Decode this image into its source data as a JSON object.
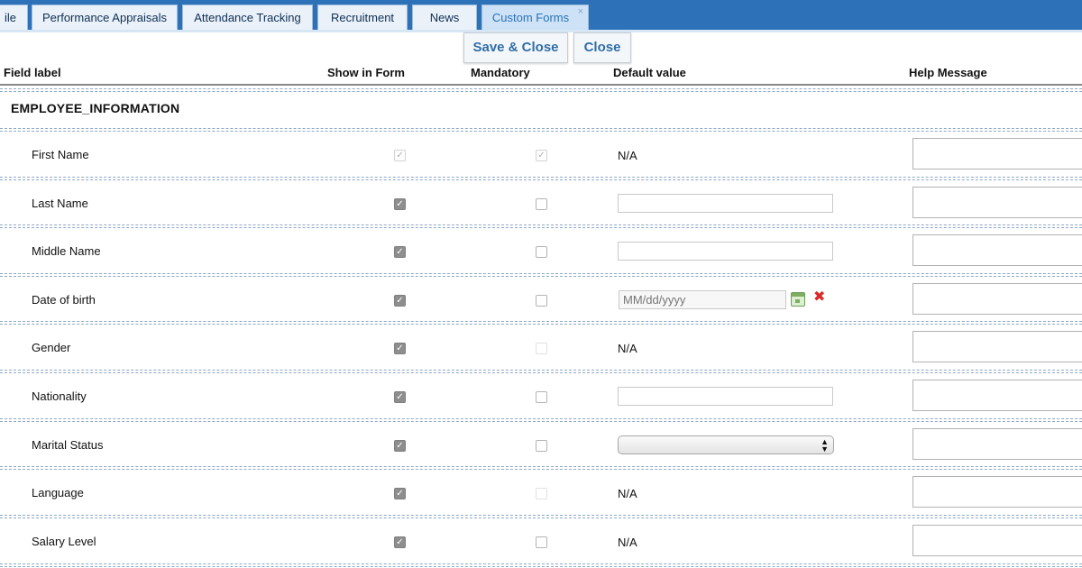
{
  "tabs": [
    {
      "label": "ile"
    },
    {
      "label": "Performance Appraisals"
    },
    {
      "label": "Attendance Tracking"
    },
    {
      "label": "Recruitment"
    },
    {
      "label": "News"
    },
    {
      "label": "Custom Forms",
      "close": "×"
    }
  ],
  "toolbar": {
    "save_close_label": "Save & Close",
    "close_label": "Close"
  },
  "columns": {
    "field_label": "Field label",
    "show_in_form": "Show in Form",
    "mandatory": "Mandatory",
    "default_value": "Default value",
    "help_message": "Help Message"
  },
  "section": {
    "title": "EMPLOYEE_INFORMATION"
  },
  "rows": [
    {
      "label": "First Name",
      "show": "checked-disabled",
      "mandatory": "checked-disabled",
      "default_type": "na",
      "default_text": "N/A"
    },
    {
      "label": "Last Name",
      "show": "checked",
      "mandatory": "unchecked",
      "default_type": "text",
      "default_text": ""
    },
    {
      "label": "Middle Name",
      "show": "checked",
      "mandatory": "unchecked",
      "default_type": "text",
      "default_text": ""
    },
    {
      "label": "Date of birth",
      "show": "checked",
      "mandatory": "unchecked",
      "default_type": "date",
      "default_placeholder": "MM/dd/yyyy"
    },
    {
      "label": "Gender",
      "show": "checked",
      "mandatory": "disabled",
      "default_type": "na",
      "default_text": "N/A"
    },
    {
      "label": "Nationality",
      "show": "checked",
      "mandatory": "unchecked",
      "default_type": "text",
      "default_text": ""
    },
    {
      "label": "Marital Status",
      "show": "checked",
      "mandatory": "unchecked",
      "default_type": "select",
      "default_text": ""
    },
    {
      "label": "Language",
      "show": "checked",
      "mandatory": "disabled",
      "default_type": "na",
      "default_text": "N/A"
    },
    {
      "label": "Salary Level",
      "show": "checked",
      "mandatory": "unchecked",
      "default_type": "na",
      "default_text": "N/A"
    }
  ],
  "icons": {
    "checkmark": "✓",
    "calendar": "calendar-icon",
    "clear": "✖",
    "select_arrows": "▲▼"
  },
  "colors": {
    "tabbar": "#2d72b8",
    "active_tab_text": "#2a73b8",
    "button_text": "#2f6ea8",
    "clear_icon": "#d92a2a"
  }
}
